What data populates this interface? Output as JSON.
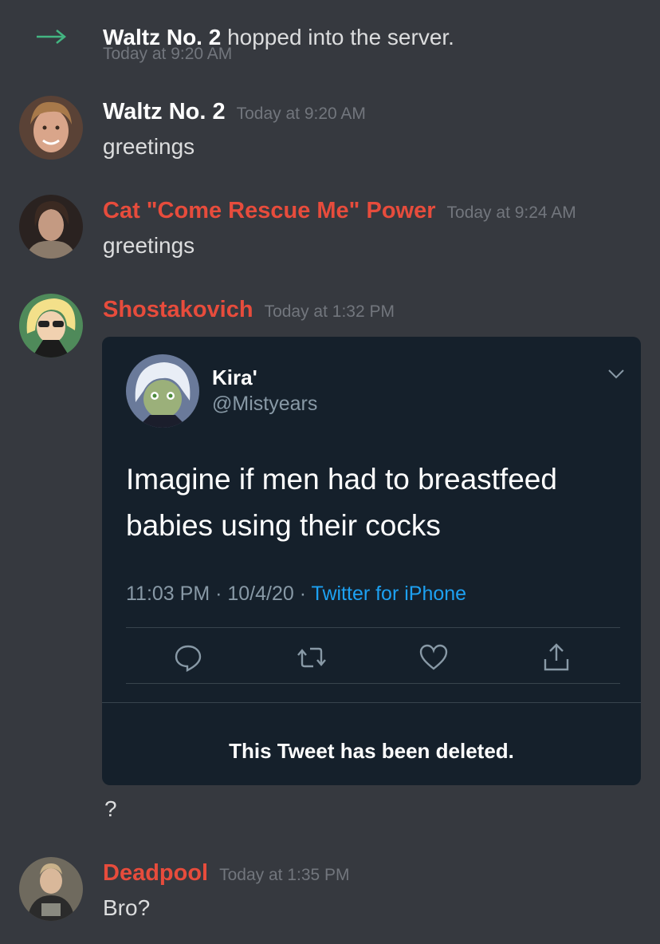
{
  "system_message": {
    "user": "Waltz No. 2",
    "text": "hopped into the server.",
    "time": "Today at 9:20 AM",
    "icon": "join-arrow-icon",
    "arrow_color": "#43b581"
  },
  "messages": [
    {
      "author": "Waltz No. 2",
      "author_color": "#ffffff",
      "time": "Today at 9:20 AM",
      "text": "greetings"
    },
    {
      "author": "Cat \"Come Rescue Me\" Power",
      "author_color": "#e74c3c",
      "time": "Today at 9:24 AM",
      "text": "greetings"
    },
    {
      "author": "Shostakovich",
      "author_color": "#e74c3c",
      "time": "Today at 1:32 PM",
      "embed": {
        "name": "Kira'",
        "handle": "@Mistyears",
        "body": "Imagine if men had to breastfeed babies using their cocks",
        "date": "11:03 PM · 10/4/20 · ",
        "source": "Twitter for iPhone",
        "deleted_notice": "This Tweet has been deleted.",
        "actions": [
          "reply-icon",
          "retweet-icon",
          "like-icon",
          "share-icon"
        ]
      },
      "followup": "?"
    },
    {
      "author": "Deadpool",
      "author_color": "#e74c3c",
      "time": "Today at 1:35 PM",
      "text": "Bro?"
    }
  ]
}
